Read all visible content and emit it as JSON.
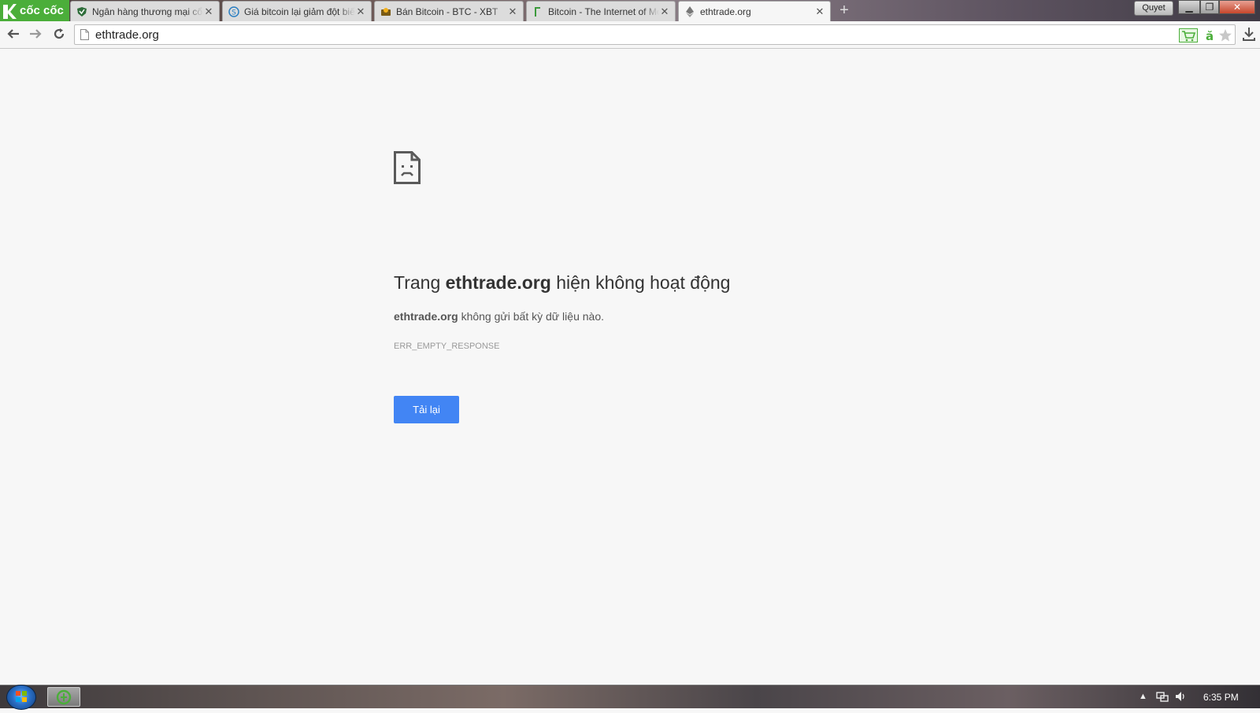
{
  "browser": {
    "logo_text": "cốc cốc",
    "profile_label": "Quyet",
    "colors": {
      "brand": "#4bae3a",
      "button": "#4285f4"
    },
    "tabs": [
      {
        "title": "Ngân hàng thương mại cổ",
        "favicon": "shield-icon",
        "active": false
      },
      {
        "title": "Giá bitcoin lại giảm đột biến",
        "favicon": "s-circle-icon",
        "active": false
      },
      {
        "title": "Bán Bitcoin - BTC - XBT",
        "favicon": "wallet-icon",
        "active": false
      },
      {
        "title": "Bitcoin - The Internet of Money",
        "favicon": "bookmark-icon",
        "active": false
      },
      {
        "title": "ethtrade.org",
        "favicon": "ethereum-icon",
        "active": true
      }
    ],
    "address": "ethtrade.org"
  },
  "error": {
    "heading_prefix": "Trang ",
    "heading_domain": "ethtrade.org",
    "heading_suffix": " hiện không hoạt động",
    "desc_domain": "ethtrade.org",
    "desc_suffix": " không gửi bất kỳ dữ liệu nào.",
    "code": "ERR_EMPTY_RESPONSE",
    "reload_label": "Tải lại"
  },
  "taskbar": {
    "time": "6:35 PM"
  }
}
